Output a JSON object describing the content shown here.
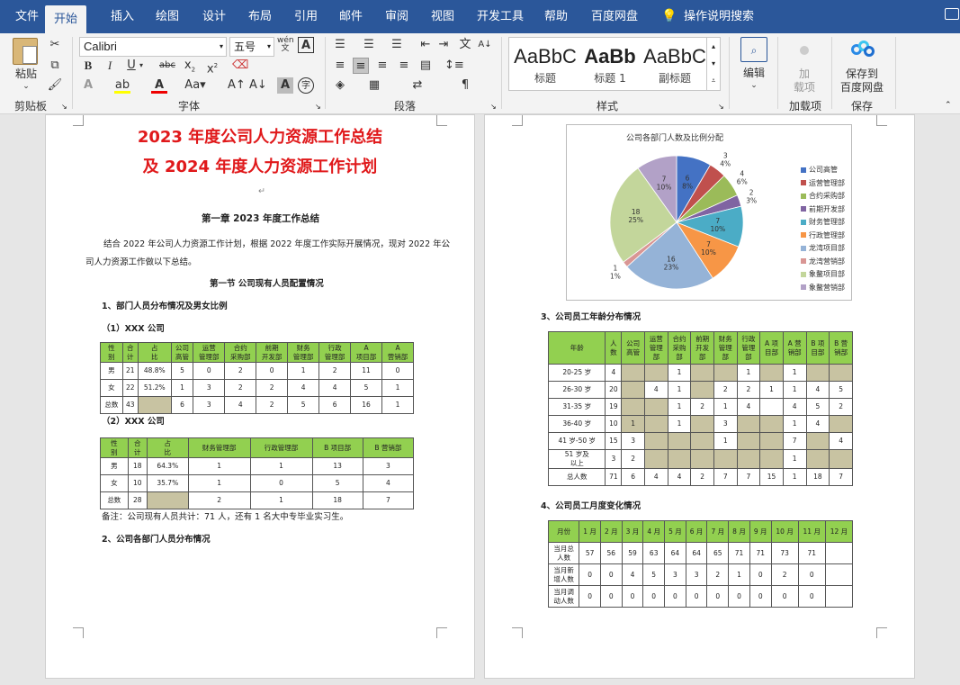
{
  "menu": {
    "tabs": [
      "文件",
      "开始",
      "插入",
      "绘图",
      "设计",
      "布局",
      "引用",
      "邮件",
      "审阅",
      "视图",
      "开发工具",
      "帮助",
      "百度网盘"
    ],
    "active_tab": "开始",
    "search_label": "操作说明搜索"
  },
  "ribbon": {
    "clipboard": {
      "paste_label": "粘贴",
      "group_label": "剪贴板"
    },
    "font": {
      "font_name": "Calibri",
      "font_size": "五号",
      "group_label": "字体",
      "wen_label": "wén\n文",
      "A_label": "A"
    },
    "paragraph": {
      "group_label": "段落"
    },
    "styles": {
      "items": [
        {
          "sample": "AaBbC",
          "name": "标题"
        },
        {
          "sample": "AaBb",
          "name": "标题 1"
        },
        {
          "sample": "AaBbC",
          "name": "副标题"
        }
      ],
      "group_label": "样式"
    },
    "edit": {
      "label": "编辑"
    },
    "addins": {
      "add_label": "加",
      "load_label": "载项",
      "group_label": "加载项"
    },
    "save": {
      "line1": "保存到",
      "line2": "百度网盘",
      "group_label": "保存"
    }
  },
  "doc_left": {
    "title1": "2023 年度公司人力资源工作总结",
    "title2": "及 2024 年度人力资源工作计划",
    "chapter": "第一章  2023 年度工作总结",
    "intro1": "结合 2022 年公司人力资源工作计划，根据 2022 年度工作实际开展情况，现对 2022 年公",
    "intro2": "司人力资源工作做以下总结。",
    "section1": "第一节  公司现有人员配置情况",
    "h1": "1、部门人员分布情况及男女比例",
    "h1a": "（1）XXX 公司",
    "h1b": "（2）XXX 公司",
    "table1": {
      "header": [
        "性\n别",
        "合\n计",
        "占\n比",
        "公司\n高管",
        "运营\n管理部",
        "合约\n采购部",
        "前期\n开发部",
        "财务\n管理部",
        "行政\n管理部",
        "A\n项目部",
        "A\n营销部"
      ],
      "rows": [
        [
          "男",
          "21",
          "48.8%",
          "5",
          "0",
          "2",
          "0",
          "1",
          "2",
          "11",
          "0"
        ],
        [
          "女",
          "22",
          "51.2%",
          "1",
          "3",
          "2",
          "2",
          "4",
          "4",
          "5",
          "1"
        ],
        [
          "总数",
          "43",
          "",
          "6",
          "3",
          "4",
          "2",
          "5",
          "6",
          "16",
          "1"
        ]
      ]
    },
    "table2": {
      "header": [
        "性\n别",
        "合\n计",
        "占\n比",
        "财务管理部",
        "行政管理部",
        "B 项目部",
        "B 营销部"
      ],
      "rows": [
        [
          "男",
          "18",
          "64.3%",
          "1",
          "1",
          "13",
          "3"
        ],
        [
          "女",
          "10",
          "35.7%",
          "1",
          "0",
          "5",
          "4"
        ],
        [
          "总数",
          "28",
          "",
          "2",
          "1",
          "18",
          "7"
        ]
      ]
    },
    "note": "备注：公司现有人员共计：71 人，还有 1 名大中专毕业实习生。",
    "h2": "2、公司各部门人员分布情况"
  },
  "doc_right": {
    "h3": "3、公司员工年龄分布情况",
    "h4": "4、公司员工月度变化情况",
    "age_table": {
      "header": [
        "年龄",
        "人\n数",
        "公司\n高管",
        "运营\n管理\n部",
        "合约\n采购\n部",
        "前期\n开发\n部",
        "财务\n管理\n部",
        "行政\n管理\n部",
        "A 项\n目部",
        "A 营\n销部",
        "B 项\n目部",
        "B 营\n销部"
      ],
      "rows": [
        [
          "20-25 岁",
          "4",
          "",
          "",
          "1",
          "",
          "",
          "1",
          "",
          "1",
          "",
          ""
        ],
        [
          "26-30 岁",
          "20",
          "",
          "4",
          "1",
          "",
          "2",
          "2",
          "1",
          "1",
          "4",
          "5"
        ],
        [
          "31-35 岁",
          "19",
          "",
          "",
          "1",
          "2",
          "1",
          "4",
          "",
          "4",
          "5",
          "2"
        ],
        [
          "36-40 岁",
          "10",
          "1",
          "",
          "1",
          "",
          "3",
          "",
          "",
          "1",
          "4",
          ""
        ],
        [
          "41 岁-50 岁",
          "15",
          "3",
          "",
          "",
          "",
          "1",
          "",
          "",
          "7",
          "",
          "4"
        ],
        [
          "51 岁及\n以上",
          "3",
          "2",
          "",
          "",
          "",
          "",
          "",
          "",
          "1",
          "",
          ""
        ],
        [
          "总人数",
          "71",
          "6",
          "4",
          "4",
          "2",
          "7",
          "7",
          "15",
          "1",
          "18",
          "7"
        ]
      ],
      "gray": [
        [
          2,
          3,
          5,
          6,
          8,
          10,
          11
        ],
        [
          2,
          5
        ],
        [
          2,
          3
        ],
        [
          2,
          3,
          5,
          7,
          8,
          11
        ],
        [
          3,
          4,
          5,
          7,
          8,
          10
        ],
        [
          3,
          4,
          5,
          6,
          7,
          8,
          10,
          11
        ],
        []
      ]
    },
    "month_table": {
      "header": [
        "月份",
        "1 月",
        "2 月",
        "3 月",
        "4 月",
        "5 月",
        "6 月",
        "7 月",
        "8 月",
        "9 月",
        "10 月",
        "11 月",
        "12 月"
      ],
      "rows": [
        [
          "当月总\n人数",
          "57",
          "56",
          "59",
          "63",
          "64",
          "64",
          "65",
          "71",
          "71",
          "73",
          "71",
          ""
        ],
        [
          "当月新\n增人数",
          "0",
          "0",
          "4",
          "5",
          "3",
          "3",
          "2",
          "1",
          "0",
          "2",
          "0",
          ""
        ],
        [
          "当月调\n动人数",
          "0",
          "0",
          "0",
          "0",
          "0",
          "0",
          "0",
          "0",
          "0",
          "0",
          "0",
          ""
        ]
      ]
    }
  },
  "chart_data": {
    "type": "pie",
    "title": "公司各部门人数及比例分配",
    "slices": [
      {
        "name": "公司高管",
        "value": 6,
        "pct": "8%",
        "color": "#4472c4"
      },
      {
        "name": "运营管理部",
        "value": 3,
        "pct": "4%",
        "color": "#c0504d"
      },
      {
        "name": "合约采购部",
        "value": 4,
        "pct": "6%",
        "color": "#9bbb59"
      },
      {
        "name": "前期开发部",
        "value": 2,
        "pct": "3%",
        "color": "#8064a2"
      },
      {
        "name": "财务管理部",
        "value": 7,
        "pct": "10%",
        "color": "#4bacc6"
      },
      {
        "name": "行政管理部",
        "value": 7,
        "pct": "10%",
        "color": "#f79646"
      },
      {
        "name": "龙湾项目部",
        "value": 16,
        "pct": "23%",
        "color": "#95b3d7"
      },
      {
        "name": "龙湾营销部",
        "value": 1,
        "pct": "1%",
        "color": "#d99694"
      },
      {
        "name": "象鳌项目部",
        "value": 18,
        "pct": "25%",
        "color": "#c3d69b"
      },
      {
        "name": "象鳌营销部",
        "value": 7,
        "pct": "10%",
        "color": "#b2a1c7"
      }
    ],
    "legend": "right"
  }
}
